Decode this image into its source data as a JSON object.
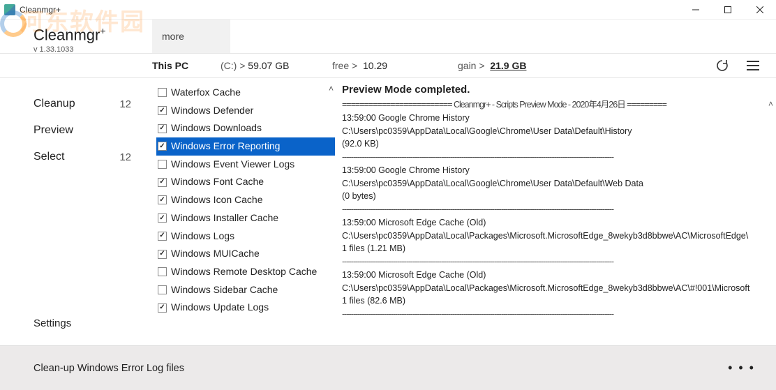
{
  "window": {
    "title": "Cleanmgr+"
  },
  "watermark": "河东软件园",
  "app": {
    "name": "Cleanmgr",
    "version": "v 1.33.1033",
    "more_tab": "more"
  },
  "info": {
    "thispc": "This PC",
    "drive_label": "(C:) >",
    "drive_total": "59.07 GB",
    "free_label": "free  >",
    "free_value": "10.29",
    "gain_label": "gain  >",
    "gain_value": "21.9 GB"
  },
  "sidebar": {
    "items": [
      {
        "label": "Cleanup",
        "badge": "12"
      },
      {
        "label": "Preview",
        "badge": ""
      },
      {
        "label": "Select",
        "badge": "12"
      }
    ],
    "settings": "Settings"
  },
  "checklist": [
    {
      "label": "Waterfox Cache",
      "checked": false,
      "selected": false
    },
    {
      "label": "Windows Defender",
      "checked": true,
      "selected": false
    },
    {
      "label": "Windows Downloads",
      "checked": true,
      "selected": false
    },
    {
      "label": "Windows Error Reporting",
      "checked": true,
      "selected": true
    },
    {
      "label": "Windows Event Viewer Logs",
      "checked": false,
      "selected": false
    },
    {
      "label": "Windows Font Cache",
      "checked": true,
      "selected": false
    },
    {
      "label": "Windows Icon Cache",
      "checked": true,
      "selected": false
    },
    {
      "label": "Windows Installer Cache",
      "checked": true,
      "selected": false
    },
    {
      "label": "Windows Logs",
      "checked": true,
      "selected": false
    },
    {
      "label": "Windows MUICache",
      "checked": true,
      "selected": false
    },
    {
      "label": "Windows Remote Desktop Cache",
      "checked": false,
      "selected": false
    },
    {
      "label": "Windows Sidebar Cache",
      "checked": false,
      "selected": false
    },
    {
      "label": "Windows Update Logs",
      "checked": true,
      "selected": false
    }
  ],
  "preview": {
    "title": "Preview Mode completed.",
    "header_line": "========================= Cleanmgr+ - Scripts Preview Mode - 2020年4月26日 =========",
    "entries": [
      {
        "time": "13:59:00",
        "name": "Google Chrome History",
        "path": "C:\\Users\\pc0359\\AppData\\Local\\Google\\Chrome\\User Data\\Default\\History",
        "size": "(92.0 KB)"
      },
      {
        "time": "13:59:00",
        "name": "Google Chrome History",
        "path": "C:\\Users\\pc0359\\AppData\\Local\\Google\\Chrome\\User Data\\Default\\Web Data",
        "size": "(0 bytes)"
      },
      {
        "time": "13:59:00",
        "name": "Microsoft Edge Cache (Old)",
        "path": "C:\\Users\\pc0359\\AppData\\Local\\Packages\\Microsoft.MicrosoftEdge_8wekyb3d8bbwe\\AC\\MicrosoftEdge\\",
        "size": "1 files (1.21 MB)"
      },
      {
        "time": "13:59:00",
        "name": "Microsoft Edge Cache (Old)",
        "path": "C:\\Users\\pc0359\\AppData\\Local\\Packages\\Microsoft.MicrosoftEdge_8wekyb3d8bbwe\\AC\\#!001\\Microsoft",
        "size": "1 files (82.6 MB)"
      }
    ],
    "separator": "---------------------------------------------------------------------------------------------------------------------------"
  },
  "status": {
    "text": "Clean-up Windows Error Log files"
  },
  "icons": {
    "refresh": "refresh-icon",
    "menu": "hamburger-icon"
  }
}
